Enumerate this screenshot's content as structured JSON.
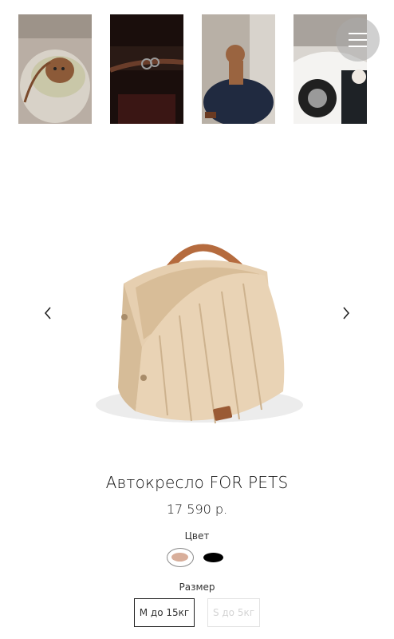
{
  "gallery": {
    "thumbnails": [
      {
        "name": "dog-in-bag-photo"
      },
      {
        "name": "bag-strap-detail-photo"
      },
      {
        "name": "poodle-on-seat-photo"
      },
      {
        "name": "car-with-dog-photo"
      }
    ]
  },
  "menu": {
    "icon": "hamburger-menu-icon"
  },
  "carousel": {
    "prev_icon": "chevron-left-icon",
    "next_icon": "chevron-right-icon"
  },
  "product": {
    "title": "Автокресло FOR PETS",
    "price": "17 590 р.",
    "color_label": "Цвет",
    "colors": [
      {
        "name": "beige",
        "hex": "#d8ae9a",
        "selected": true
      },
      {
        "name": "black",
        "hex": "#000000",
        "selected": false
      }
    ],
    "size_label": "Размер",
    "sizes": [
      {
        "label": "M до 15кг",
        "selected": true,
        "available": true
      },
      {
        "label": "S до 5кг",
        "selected": false,
        "available": false
      }
    ]
  }
}
